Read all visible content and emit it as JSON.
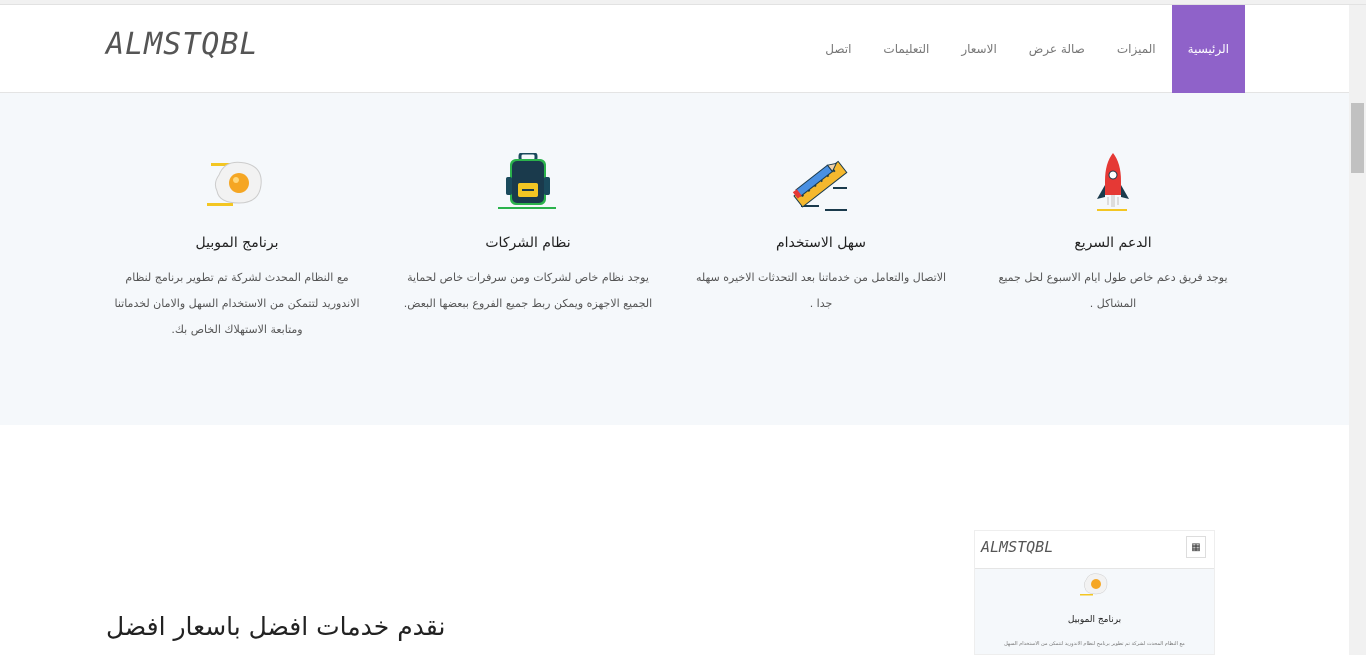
{
  "brand": "ALMSTQBL",
  "nav": [
    {
      "label": "الرئيسية",
      "active": true
    },
    {
      "label": "الميزات"
    },
    {
      "label": "صالة عرض"
    },
    {
      "label": "الاسعار"
    },
    {
      "label": "التعليمات"
    },
    {
      "label": "اتصل"
    }
  ],
  "features": [
    {
      "title": "برنامج الموبيل",
      "text": "مع النظام المحدث لشركة تم تطوير برنامج لنظام الاندوريد لتتمكن من الاستخدام السهل والامان لخدماتنا ومتابعة الاستهلاك الخاص بك.",
      "icon": "egg-icon"
    },
    {
      "title": "نظام الشركات",
      "text": "يوجد نظام خاص لشركات ومن سرفرات خاص لحماية الجميع الاجهزه ويمكن ربط جميع الفروع ببعضها البعض.",
      "icon": "backpack-icon"
    },
    {
      "title": "سهل الاستخدام",
      "text": "الاتصال والتعامل من خدماتنا بعد التحدثات الاخيره سهله جدا .",
      "icon": "pencil-ruler-icon"
    },
    {
      "title": "الدعم السريع",
      "text": "يوجد فريق دعم خاص طول ايام الاسبوع لحل جميع المشاكل .",
      "icon": "rocket-icon"
    }
  ],
  "heading": "نقدم خدمات افضل باسعار افضل",
  "preview": {
    "brand": "ALMSTQBL",
    "menu_icon": "grid-menu-icon",
    "title": "برنامج الموبيل",
    "text": "مع النظام المحدث لشركة تم تطوير برنامج لنظام الاندوريد لتتمكن من الاستخدام السهل"
  }
}
